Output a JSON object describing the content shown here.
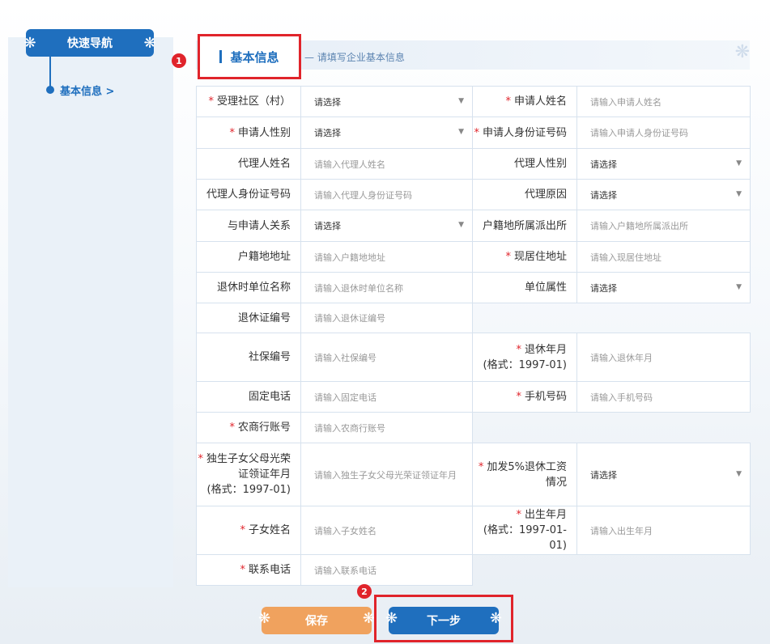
{
  "sidebar": {
    "title": "快速导航",
    "items": [
      {
        "label": "基本信息 >"
      }
    ]
  },
  "section": {
    "title": "基本信息",
    "subtitle": "— 请填写企业基本信息"
  },
  "badges": [
    "1",
    "2"
  ],
  "form": {
    "select_placeholder": "请选择",
    "rows": [
      [
        {
          "label": "受理社区（村）",
          "required": true,
          "type": "select",
          "value": "请选择"
        },
        {
          "label": "申请人姓名",
          "required": true,
          "type": "input",
          "placeholder": "请输入申请人姓名"
        }
      ],
      [
        {
          "label": "申请人性别",
          "required": true,
          "type": "select",
          "value": "请选择"
        },
        {
          "label": "申请人身份证号码",
          "required": true,
          "type": "input",
          "placeholder": "请输入申请人身份证号码"
        }
      ],
      [
        {
          "label": "代理人姓名",
          "required": false,
          "type": "input",
          "placeholder": "请输入代理人姓名"
        },
        {
          "label": "代理人性别",
          "required": false,
          "type": "select",
          "value": "请选择"
        }
      ],
      [
        {
          "label": "代理人身份证号码",
          "required": false,
          "type": "input",
          "placeholder": "请输入代理人身份证号码"
        },
        {
          "label": "代理原因",
          "required": false,
          "type": "select",
          "value": "请选择"
        }
      ],
      [
        {
          "label": "与申请人关系",
          "required": false,
          "type": "select",
          "value": "请选择"
        },
        {
          "label": "户籍地所属派出所",
          "required": false,
          "type": "input",
          "placeholder": "请输入户籍地所属派出所"
        }
      ],
      [
        {
          "label": "户籍地地址",
          "required": false,
          "type": "input",
          "placeholder": "请输入户籍地地址"
        },
        {
          "label": "现居住地址",
          "required": true,
          "type": "input",
          "placeholder": "请输入现居住地址"
        }
      ],
      [
        {
          "label": "退休时单位名称",
          "required": false,
          "type": "input",
          "placeholder": "请输入退休时单位名称"
        },
        {
          "label": "单位属性",
          "required": false,
          "type": "select",
          "value": "请选择"
        }
      ],
      [
        {
          "label": "退休证编号",
          "required": false,
          "type": "input",
          "placeholder": "请输入退休证编号"
        }
      ],
      [
        {
          "label": "社保编号",
          "required": false,
          "type": "input",
          "placeholder": "请输入社保编号"
        },
        {
          "label": "退休年月\n(格式：1997-01)",
          "required": true,
          "type": "input",
          "placeholder": "请输入退休年月"
        }
      ],
      [
        {
          "label": "固定电话",
          "required": false,
          "type": "input",
          "placeholder": "请输入固定电话"
        },
        {
          "label": "手机号码",
          "required": true,
          "type": "input",
          "placeholder": "请输入手机号码"
        }
      ],
      [
        {
          "label": "农商行账号",
          "required": true,
          "type": "input",
          "placeholder": "请输入农商行账号"
        }
      ],
      [
        {
          "label": "独生子女父母光荣\n证领证年月\n(格式：1997-01)",
          "required": true,
          "type": "input",
          "placeholder": "请输入独生子女父母光荣证领证年月"
        },
        {
          "label": "加发5%退休工资\n情况",
          "required": true,
          "type": "select",
          "value": "请选择"
        }
      ],
      [
        {
          "label": "子女姓名",
          "required": true,
          "type": "input",
          "placeholder": "请输入子女姓名"
        },
        {
          "label": "出生年月\n(格式：1997-01-01)",
          "required": true,
          "type": "input",
          "placeholder": "请输入出生年月"
        }
      ],
      [
        {
          "label": "联系电话",
          "required": true,
          "type": "input",
          "placeholder": "请输入联系电话"
        }
      ]
    ]
  },
  "buttons": {
    "save": "保存",
    "next": "下一步"
  },
  "colors": {
    "primary": "#1f6fbe",
    "accent_orange": "#f0a25e",
    "highlight_red": "#e0242b"
  }
}
